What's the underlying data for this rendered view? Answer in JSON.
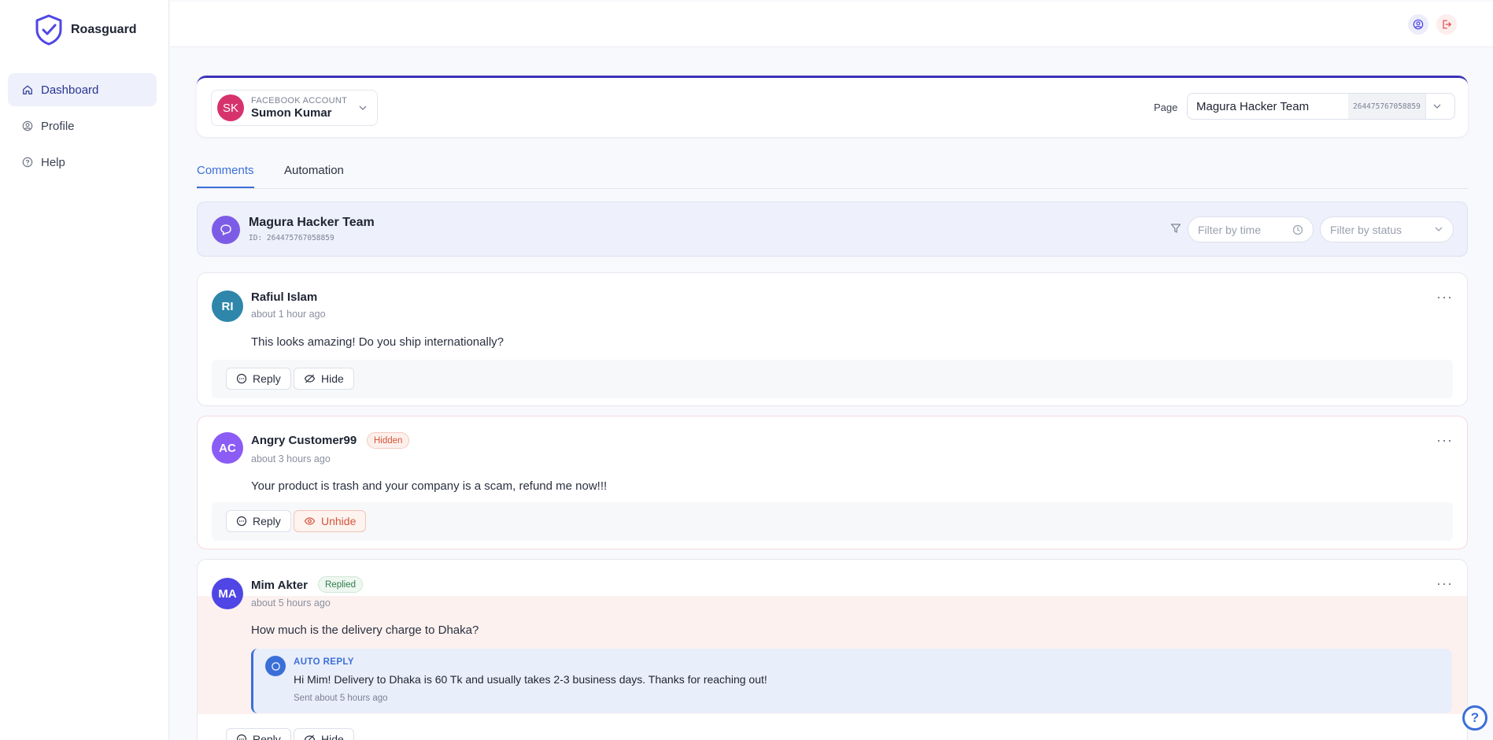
{
  "app": {
    "name": "Roasguard"
  },
  "sidebar": {
    "items": [
      {
        "label": "Dashboard",
        "icon": "home-icon",
        "active": true
      },
      {
        "label": "Profile",
        "icon": "user-circle-icon",
        "active": false
      },
      {
        "label": "Help",
        "icon": "help-circle-icon",
        "active": false
      }
    ]
  },
  "account": {
    "label": "FACEBOOK ACCOUNT",
    "initials": "SK",
    "name": "Sumon Kumar"
  },
  "page_selector": {
    "label": "Page",
    "name": "Magura Hacker Team",
    "id": "264475767058859"
  },
  "tabs": [
    {
      "label": "Comments",
      "active": true
    },
    {
      "label": "Automation",
      "active": false
    }
  ],
  "page_header": {
    "name": "Magura Hacker Team",
    "id": "ID: 264475767058859",
    "filter_time_placeholder": "Filter by time",
    "filter_status_placeholder": "Filter by status"
  },
  "comments": [
    {
      "initials": "RI",
      "avatar_color": "#2e86ab",
      "author": "Rafiul Islam",
      "time": "about 1 hour ago",
      "text": "This looks amazing! Do you ship internationally?",
      "actions": [
        "Reply",
        "Hide"
      ]
    },
    {
      "initials": "AC",
      "avatar_color": "#8b5cf6",
      "author": "Angry Customer99",
      "badge": "Hidden",
      "time": "about 3 hours ago",
      "text": "Your product is trash and your company is a scam, refund me now!!!",
      "actions": [
        "Reply",
        "Unhide"
      ]
    },
    {
      "initials": "MA",
      "avatar_color": "#4f46e5",
      "author": "Mim Akter",
      "badge": "Replied",
      "time": "about 5 hours ago",
      "text": "How much is the delivery charge to Dhaka?",
      "auto_reply": {
        "label": "AUTO REPLY",
        "text": "Hi Mim! Delivery to Dhaka is 60 Tk and usually takes 2-3 business days. Thanks for reaching out!",
        "time": "Sent about 5 hours ago"
      },
      "actions": [
        "Reply",
        "Hide"
      ]
    }
  ],
  "more_label": "···",
  "help_fab_label": "?"
}
